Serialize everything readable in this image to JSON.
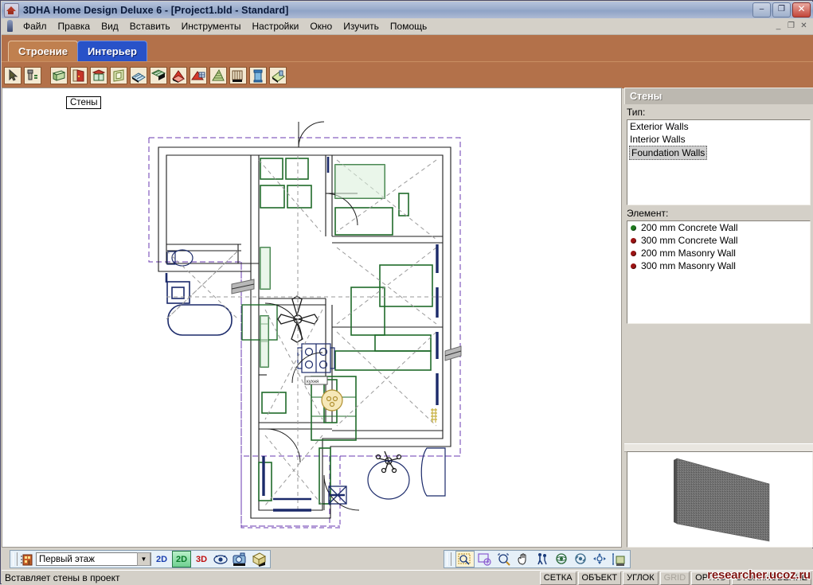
{
  "window": {
    "title": "3DHA Home Design Deluxe 6  - [Project1.bld - Standard]",
    "app_icon": "house-icon",
    "minimize_label": "–",
    "maximize_label": "❐",
    "close_label": "✕",
    "mdi_minimize": "_",
    "mdi_restore": "❐",
    "mdi_close": "✕"
  },
  "menu": {
    "icon": "assistant-icon",
    "items": [
      {
        "label": "Файл",
        "name": "menu-file"
      },
      {
        "label": "Правка",
        "name": "menu-edit"
      },
      {
        "label": "Вид",
        "name": "menu-view"
      },
      {
        "label": "Вставить",
        "name": "menu-insert"
      },
      {
        "label": "Инструменты",
        "name": "menu-tools"
      },
      {
        "label": "Настройки",
        "name": "menu-settings"
      },
      {
        "label": "Окно",
        "name": "menu-window"
      },
      {
        "label": "Изучить",
        "name": "menu-learn"
      },
      {
        "label": "Помощь",
        "name": "menu-help"
      }
    ]
  },
  "tabs": [
    {
      "label": "Строение",
      "active": true
    },
    {
      "label": "Интерьер",
      "active": false
    }
  ],
  "toolbar": {
    "tools": [
      {
        "name": "select-arrow-icon",
        "title": "Выбрать"
      },
      {
        "name": "paint-spray-icon",
        "title": "Материал"
      },
      {
        "name": "wall-icon",
        "title": "Стены"
      },
      {
        "name": "door-icon",
        "title": "Двери"
      },
      {
        "name": "window-icon",
        "title": "Окна"
      },
      {
        "name": "opening-icon",
        "title": "Проём"
      },
      {
        "name": "floor-icon",
        "title": "Пол"
      },
      {
        "name": "ceiling-icon",
        "title": "Потолок"
      },
      {
        "name": "roof-icon",
        "title": "Крыша"
      },
      {
        "name": "roof-edge-icon",
        "title": "Край крыши"
      },
      {
        "name": "stairs-icon",
        "title": "Лестница"
      },
      {
        "name": "railing-icon",
        "title": "Перила"
      },
      {
        "name": "column-icon",
        "title": "Колонна"
      },
      {
        "name": "deck-icon",
        "title": "Терраса"
      }
    ]
  },
  "canvas": {
    "floating_label": "Стены"
  },
  "right_panel": {
    "header": "Стены",
    "type_label": "Тип:",
    "types": [
      {
        "label": "Exterior Walls",
        "selected": false
      },
      {
        "label": "Interior Walls",
        "selected": false
      },
      {
        "label": "Foundation Walls",
        "selected": true
      }
    ],
    "element_label": "Элемент:",
    "elements": [
      {
        "label": "200 mm Concrete Wall",
        "color": "#1f7a1f",
        "selected": true
      },
      {
        "label": "300 mm Concrete Wall",
        "color": "#9c1414",
        "selected": false
      },
      {
        "label": "200 mm Masonry Wall",
        "color": "#9c1414",
        "selected": false
      },
      {
        "label": "300 mm Masonry Wall",
        "color": "#9c1414",
        "selected": false
      }
    ],
    "preview_name": "concrete-wall-3d-preview"
  },
  "bottom_bar": {
    "floor_icon": "building-icon",
    "floor_value": "Первый этаж",
    "floor_arrow": "▼",
    "view_buttons": [
      {
        "label": "2D",
        "name": "view-2d-plan-button",
        "color": "#1a3fb0"
      },
      {
        "label": "2D",
        "name": "view-2d-color-button",
        "color": "#0a7a2a"
      },
      {
        "label": "3D",
        "name": "view-3d-button",
        "color": "#c01010"
      }
    ],
    "extra_icons": [
      {
        "name": "eye-walkthrough-icon"
      },
      {
        "name": "camera-icon"
      },
      {
        "name": "cube-view-icon"
      }
    ],
    "nav_icons": [
      {
        "name": "zoom-window-icon"
      },
      {
        "name": "zoom-extents-icon"
      },
      {
        "name": "zoom-in-out-icon"
      },
      {
        "name": "pan-hand-icon"
      },
      {
        "name": "walk-icon"
      },
      {
        "name": "orbit-icon"
      },
      {
        "name": "rotate-view-icon"
      },
      {
        "name": "move-view-icon"
      },
      {
        "name": "elevation-icon"
      }
    ]
  },
  "status": {
    "message": "Вставляет стены в проект",
    "cells": [
      {
        "label": "СЕТКА",
        "enabled": true
      },
      {
        "label": "ОБЪЕКТ",
        "enabled": true
      },
      {
        "label": "УГЛОК",
        "enabled": true
      },
      {
        "label": "GRID",
        "enabled": false
      },
      {
        "label": "ОРТНО",
        "enabled": true
      },
      {
        "label": "СТОЛКНОВЕНИЕ",
        "enabled": true
      }
    ],
    "watermark": "researcher.ucoz.ru"
  },
  "colors": {
    "title_bar": "#9aaccb",
    "tab_active": "#c0804f",
    "tab_inactive": "#2852c8",
    "toolbar_bg": "#b3714a",
    "chrome": "#d4d0c8",
    "plan_wall": "#1a1a5a",
    "plan_green": "#1f6b2a"
  }
}
